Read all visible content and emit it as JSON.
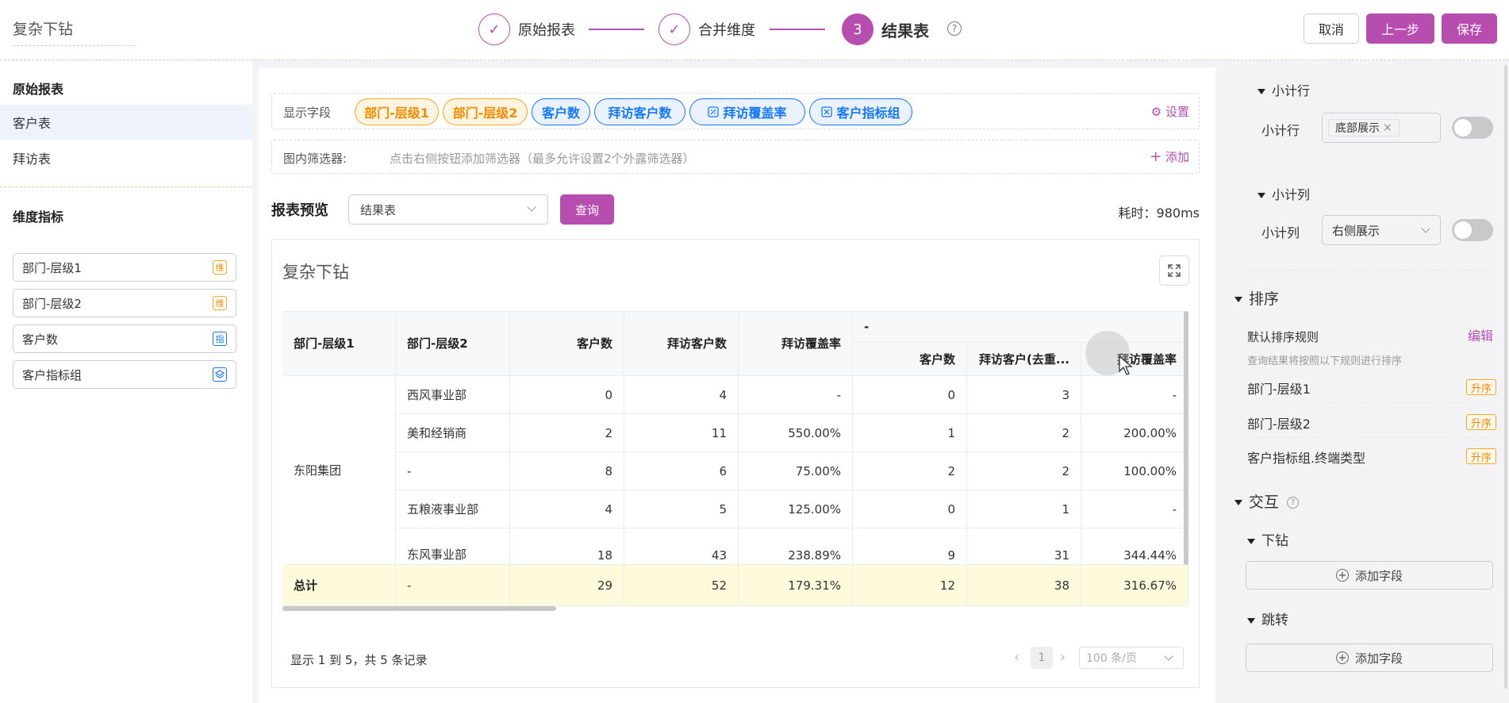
{
  "header": {
    "title": "复杂下钻",
    "steps": [
      {
        "label": "原始报表",
        "mark": "✓"
      },
      {
        "label": "合并维度",
        "mark": "✓"
      },
      {
        "label": "结果表",
        "num": "3"
      }
    ],
    "help": "?",
    "buttons": {
      "cancel": "取消",
      "prev": "上一步",
      "save": "保存"
    },
    "accent": "#b84db0"
  },
  "left": {
    "section1": "原始报表",
    "reports": [
      "客户表",
      "拜访表"
    ],
    "section2": "维度指标",
    "fields": [
      {
        "label": "部门-层级1",
        "badge": "维"
      },
      {
        "label": "部门-层级2",
        "badge": "维"
      },
      {
        "label": "客户数",
        "badge": "指"
      },
      {
        "label": "客户指标组",
        "badge": "layers-icon"
      }
    ]
  },
  "center": {
    "display_fields_label": "显示字段",
    "tags": [
      "部门-层级1",
      "部门-层级2",
      "客户数",
      "拜访客户数",
      "拜访覆盖率",
      "客户指标组"
    ],
    "settings": "设置",
    "filter_label": "图内筛选器:",
    "filter_hint": "点击右侧按钮添加筛选器（最多允许设置2个外露筛选器）",
    "filter_add": "添加",
    "preview_label": "报表预览",
    "preview_select": "结果表",
    "query": "查询",
    "elapsed": "耗时：980ms",
    "card_title": "复杂下钻",
    "table": {
      "headers": [
        "部门-层级1",
        "部门-层级2",
        "客户数",
        "拜访客户数",
        "拜访覆盖率"
      ],
      "group_header": "-",
      "sub_headers": [
        "客户数",
        "拜访客户(去重...",
        "拜访覆盖率"
      ],
      "group_value": "东阳集团",
      "rows": [
        [
          "西风事业部",
          "0",
          "4",
          "-",
          "0",
          "3",
          "-"
        ],
        [
          "美和经销商",
          "2",
          "11",
          "550.00%",
          "1",
          "2",
          "200.00%"
        ],
        [
          "-",
          "8",
          "6",
          "75.00%",
          "2",
          "2",
          "100.00%"
        ],
        [
          "五粮液事业部",
          "4",
          "5",
          "125.00%",
          "0",
          "1",
          "-"
        ],
        [
          "东风事业部",
          "18",
          "43",
          "238.89%",
          "9",
          "31",
          "344.44%"
        ]
      ],
      "total": [
        "总计",
        "-",
        "29",
        "52",
        "179.31%",
        "12",
        "38",
        "316.67%"
      ]
    },
    "pager": {
      "summary": "显示 1 到 5，共 5 条记录",
      "page": "1",
      "size": "100 条/页"
    }
  },
  "right": {
    "subtotal_row_title": "小计行",
    "subtotal_row_label": "小计行",
    "subtotal_row_value": "底部展示",
    "subtotal_col_title": "小计列",
    "subtotal_col_label": "小计列",
    "subtotal_col_value": "右侧展示",
    "sort_title": "排序",
    "sort_default": "默认排序规则",
    "sort_edit": "编辑",
    "sort_hint": "查询结果将按照以下规则进行排序",
    "sort_rules": [
      {
        "field": "部门-层级1",
        "order": "升序"
      },
      {
        "field": "部门-层级2",
        "order": "升序"
      },
      {
        "field": "客户指标组.终端类型",
        "order": "升序"
      }
    ],
    "interact_title": "交互",
    "drill_title": "下钻",
    "jump_title": "跳转",
    "add_field": "添加字段"
  }
}
